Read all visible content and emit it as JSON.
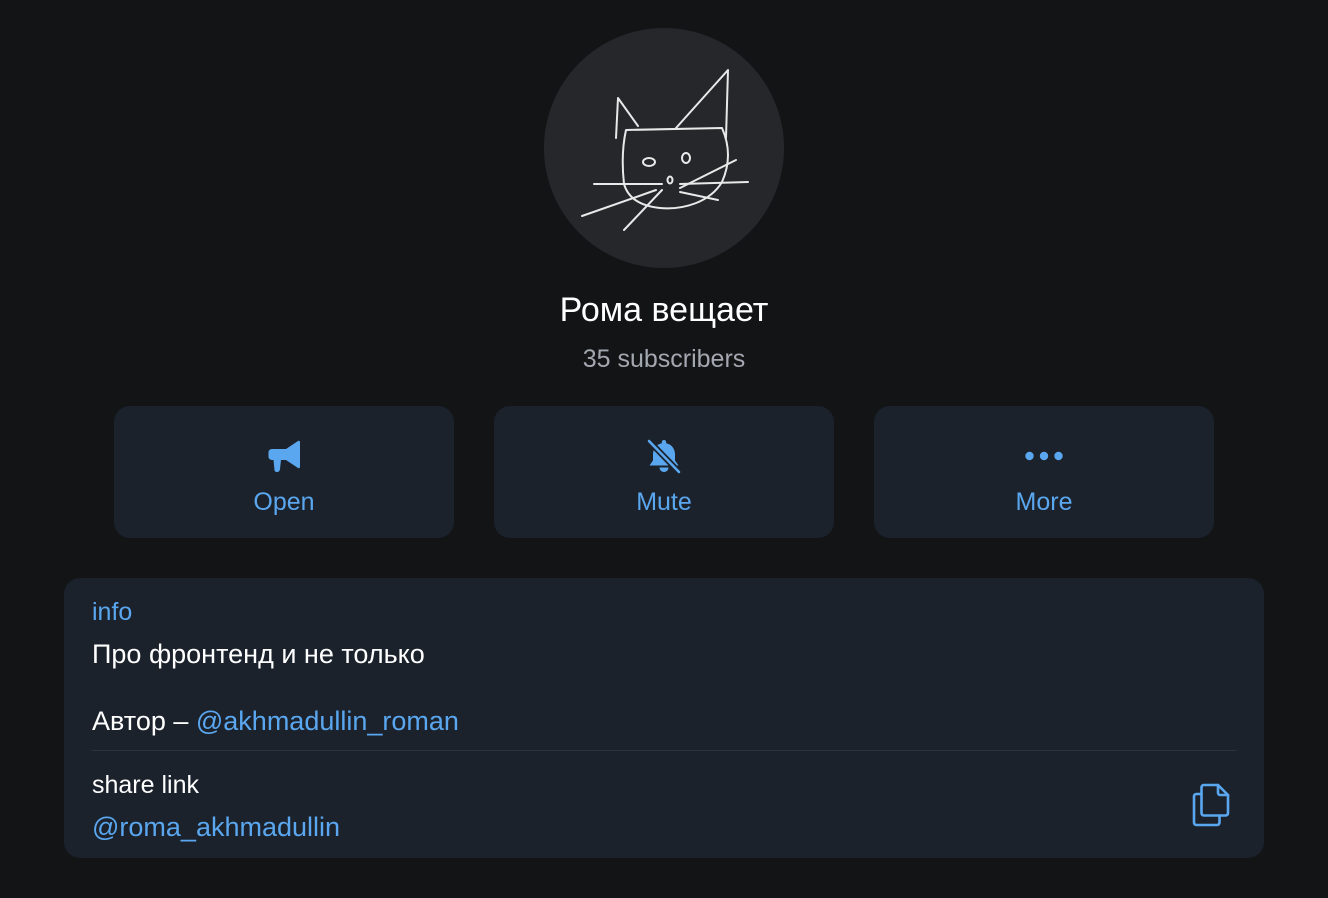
{
  "channel": {
    "name": "Рома вещает",
    "subscribers": "35 subscribers",
    "avatar_icon": "cat-doodle-avatar"
  },
  "actions": [
    {
      "label": "Open",
      "icon": "megaphone-icon"
    },
    {
      "label": "Mute",
      "icon": "bell-off-icon"
    },
    {
      "label": "More",
      "icon": "more-dots-icon"
    }
  ],
  "info": {
    "label": "info",
    "description_line1": "Про фронтенд и не только",
    "author_prefix": "Автор – ",
    "author_handle": "@akhmadullin_roman",
    "share_label": "share link",
    "share_link": "@roma_akhmadullin",
    "copy_icon": "copy-icon"
  },
  "colors": {
    "background": "#131416",
    "card": "#1b222c",
    "accent": "#5aa7ef",
    "muted_text": "#a3a8b0"
  }
}
